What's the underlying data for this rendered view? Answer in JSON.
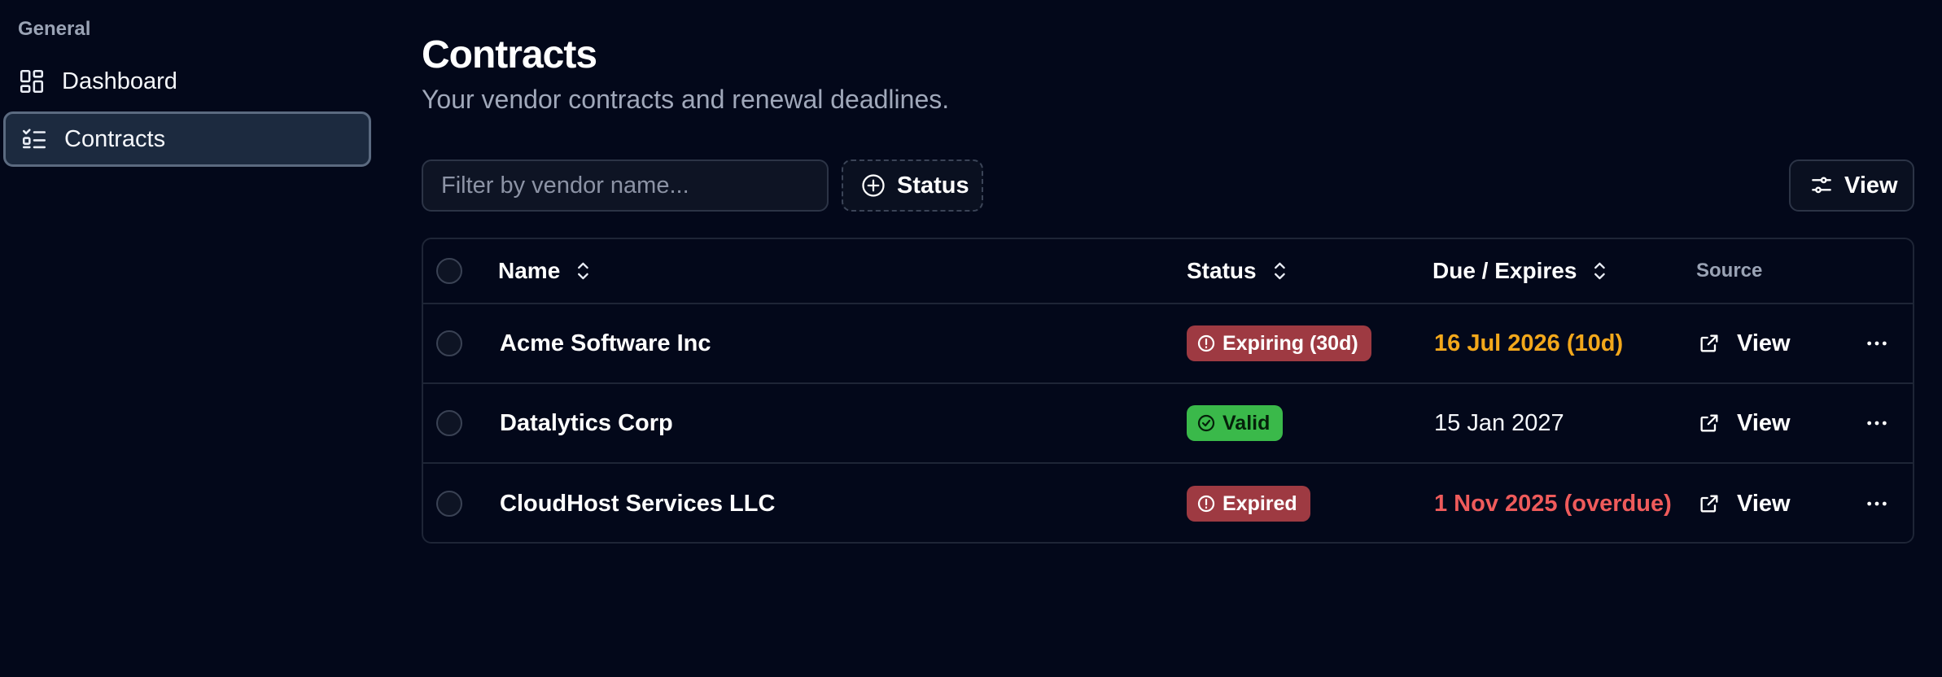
{
  "sidebar": {
    "group_label": "General",
    "items": [
      {
        "label": "Dashboard",
        "icon": "dashboard-icon",
        "active": false
      },
      {
        "label": "Contracts",
        "icon": "list-checks-icon",
        "active": true
      }
    ]
  },
  "page": {
    "title": "Contracts",
    "subtitle": "Your vendor contracts and renewal deadlines."
  },
  "toolbar": {
    "filter_placeholder": "Filter by vendor name...",
    "filter_value": "",
    "status_label": "Status",
    "view_label": "View"
  },
  "table": {
    "columns": {
      "name": "Name",
      "status": "Status",
      "due": "Due / Expires",
      "source": "Source"
    },
    "rows": [
      {
        "name": "Acme Software Inc",
        "status": "Expiring (30d)",
        "status_kind": "expiring",
        "due": "16 Jul 2026 (10d)",
        "due_kind": "warning",
        "source_label": "View"
      },
      {
        "name": "Datalytics Corp",
        "status": "Valid",
        "status_kind": "valid",
        "due": "15 Jan 2027",
        "due_kind": "normal",
        "source_label": "View"
      },
      {
        "name": "CloudHost Services LLC",
        "status": "Expired",
        "status_kind": "expired",
        "due": "1 Nov 2025 (overdue)",
        "due_kind": "overdue",
        "source_label": "View"
      }
    ]
  },
  "colors": {
    "background": "#03081a",
    "active_nav": "#1c2a3f",
    "badge_danger": "#9e3a42",
    "badge_success": "#3ab94a",
    "due_warning": "#f3a81b",
    "due_overdue": "#ef5b5b"
  }
}
